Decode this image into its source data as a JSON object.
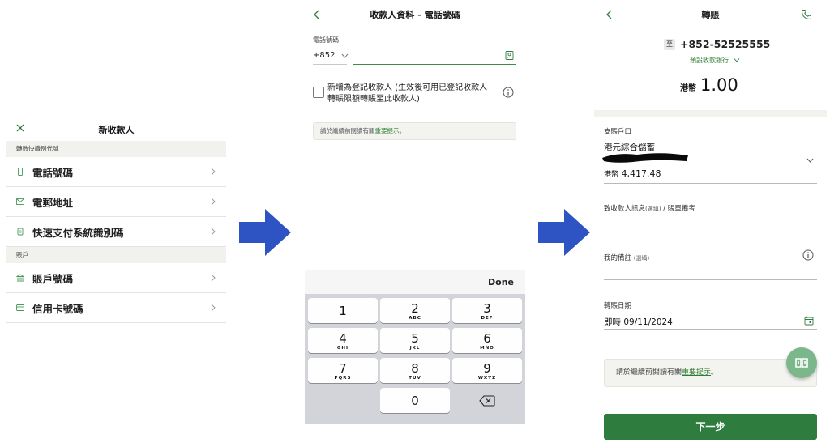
{
  "colors": {
    "accent": "#2f7d3e",
    "link": "#2e7d32",
    "arrow": "#2e53c2",
    "section_bg": "#f1f1ee"
  },
  "panel1": {
    "title": "新收款人",
    "section1": "轉數快識別代號",
    "section2": "賬戶",
    "items": [
      {
        "icon": "phone-icon",
        "label": "電話號碼"
      },
      {
        "icon": "mail-icon",
        "label": "電郵地址"
      },
      {
        "icon": "fps-id-icon",
        "label": "快速支付系統識別碼"
      },
      {
        "icon": "bank-icon",
        "label": "賬戶號碼"
      },
      {
        "icon": "credit-card-icon",
        "label": "信用卡號碼"
      }
    ]
  },
  "panel2": {
    "title": "收款人資料 - 電話號碼",
    "field_label": "電話號碼",
    "country_code": "+852",
    "phone_value": "",
    "register_text": "新增為登記收款人 (生效後可用已登記收款人轉賬限額轉賬至此收款人)",
    "note_prefix": "請於繼續前閱讀有關",
    "note_link": "重要提示",
    "note_suffix": "。",
    "keyboard": {
      "done": "Done",
      "keys": [
        {
          "n": "1",
          "l": ""
        },
        {
          "n": "2",
          "l": "ABC"
        },
        {
          "n": "3",
          "l": "DEF"
        },
        {
          "n": "4",
          "l": "GHI"
        },
        {
          "n": "5",
          "l": "JKL"
        },
        {
          "n": "6",
          "l": "MNO"
        },
        {
          "n": "7",
          "l": "PQRS"
        },
        {
          "n": "8",
          "l": "TUV"
        },
        {
          "n": "9",
          "l": "WXYZ"
        },
        {
          "n": "0",
          "l": ""
        }
      ]
    }
  },
  "panel3": {
    "title": "轉賬",
    "to_label": "至",
    "to_number": "+852-52525555",
    "bank_label": "預設收款銀行",
    "amount_currency": "港幣",
    "amount_value": "1.00",
    "from_label": "支賬戶口",
    "from_account": "港元綜合儲蓄",
    "balance_currency": "港幣",
    "balance_value": "4,417.48",
    "message_label": "致收款人訊息",
    "message_optional": "(選填)",
    "message_suffix": " / 賬單備考",
    "remark_label": "我的備註",
    "remark_optional": "(選填)",
    "date_label": "轉賬日期",
    "date_value": "即時 09/11/2024",
    "note_prefix": "請於繼續前閱讀有關",
    "note_link": "重要提示",
    "note_suffix": "。",
    "next_button": "下一步"
  }
}
